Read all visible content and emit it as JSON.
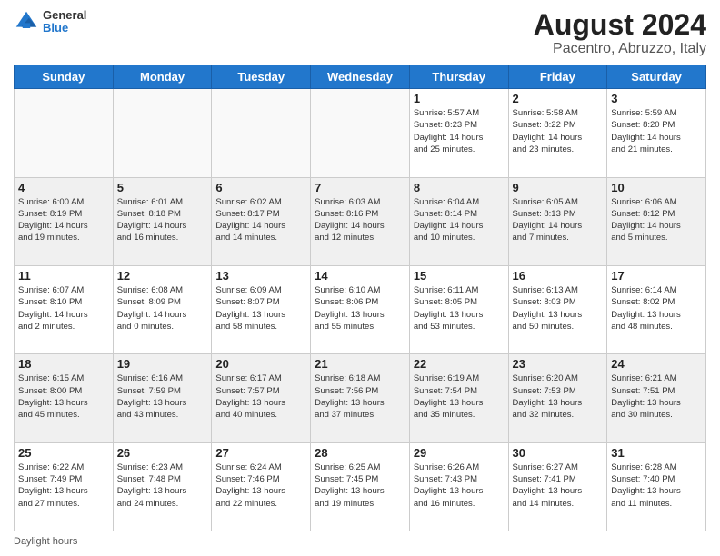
{
  "logo": {
    "text_line1": "General",
    "text_line2": "Blue"
  },
  "title": "August 2024",
  "subtitle": "Pacentro, Abruzzo, Italy",
  "days_of_week": [
    "Sunday",
    "Monday",
    "Tuesday",
    "Wednesday",
    "Thursday",
    "Friday",
    "Saturday"
  ],
  "footer_text": "Daylight hours",
  "weeks": [
    [
      {
        "day": "",
        "info": "",
        "empty": true
      },
      {
        "day": "",
        "info": "",
        "empty": true
      },
      {
        "day": "",
        "info": "",
        "empty": true
      },
      {
        "day": "",
        "info": "",
        "empty": true
      },
      {
        "day": "1",
        "info": "Sunrise: 5:57 AM\nSunset: 8:23 PM\nDaylight: 14 hours\nand 25 minutes.",
        "empty": false
      },
      {
        "day": "2",
        "info": "Sunrise: 5:58 AM\nSunset: 8:22 PM\nDaylight: 14 hours\nand 23 minutes.",
        "empty": false
      },
      {
        "day": "3",
        "info": "Sunrise: 5:59 AM\nSunset: 8:20 PM\nDaylight: 14 hours\nand 21 minutes.",
        "empty": false
      }
    ],
    [
      {
        "day": "4",
        "info": "Sunrise: 6:00 AM\nSunset: 8:19 PM\nDaylight: 14 hours\nand 19 minutes.",
        "empty": false
      },
      {
        "day": "5",
        "info": "Sunrise: 6:01 AM\nSunset: 8:18 PM\nDaylight: 14 hours\nand 16 minutes.",
        "empty": false
      },
      {
        "day": "6",
        "info": "Sunrise: 6:02 AM\nSunset: 8:17 PM\nDaylight: 14 hours\nand 14 minutes.",
        "empty": false
      },
      {
        "day": "7",
        "info": "Sunrise: 6:03 AM\nSunset: 8:16 PM\nDaylight: 14 hours\nand 12 minutes.",
        "empty": false
      },
      {
        "day": "8",
        "info": "Sunrise: 6:04 AM\nSunset: 8:14 PM\nDaylight: 14 hours\nand 10 minutes.",
        "empty": false
      },
      {
        "day": "9",
        "info": "Sunrise: 6:05 AM\nSunset: 8:13 PM\nDaylight: 14 hours\nand 7 minutes.",
        "empty": false
      },
      {
        "day": "10",
        "info": "Sunrise: 6:06 AM\nSunset: 8:12 PM\nDaylight: 14 hours\nand 5 minutes.",
        "empty": false
      }
    ],
    [
      {
        "day": "11",
        "info": "Sunrise: 6:07 AM\nSunset: 8:10 PM\nDaylight: 14 hours\nand 2 minutes.",
        "empty": false
      },
      {
        "day": "12",
        "info": "Sunrise: 6:08 AM\nSunset: 8:09 PM\nDaylight: 14 hours\nand 0 minutes.",
        "empty": false
      },
      {
        "day": "13",
        "info": "Sunrise: 6:09 AM\nSunset: 8:07 PM\nDaylight: 13 hours\nand 58 minutes.",
        "empty": false
      },
      {
        "day": "14",
        "info": "Sunrise: 6:10 AM\nSunset: 8:06 PM\nDaylight: 13 hours\nand 55 minutes.",
        "empty": false
      },
      {
        "day": "15",
        "info": "Sunrise: 6:11 AM\nSunset: 8:05 PM\nDaylight: 13 hours\nand 53 minutes.",
        "empty": false
      },
      {
        "day": "16",
        "info": "Sunrise: 6:13 AM\nSunset: 8:03 PM\nDaylight: 13 hours\nand 50 minutes.",
        "empty": false
      },
      {
        "day": "17",
        "info": "Sunrise: 6:14 AM\nSunset: 8:02 PM\nDaylight: 13 hours\nand 48 minutes.",
        "empty": false
      }
    ],
    [
      {
        "day": "18",
        "info": "Sunrise: 6:15 AM\nSunset: 8:00 PM\nDaylight: 13 hours\nand 45 minutes.",
        "empty": false
      },
      {
        "day": "19",
        "info": "Sunrise: 6:16 AM\nSunset: 7:59 PM\nDaylight: 13 hours\nand 43 minutes.",
        "empty": false
      },
      {
        "day": "20",
        "info": "Sunrise: 6:17 AM\nSunset: 7:57 PM\nDaylight: 13 hours\nand 40 minutes.",
        "empty": false
      },
      {
        "day": "21",
        "info": "Sunrise: 6:18 AM\nSunset: 7:56 PM\nDaylight: 13 hours\nand 37 minutes.",
        "empty": false
      },
      {
        "day": "22",
        "info": "Sunrise: 6:19 AM\nSunset: 7:54 PM\nDaylight: 13 hours\nand 35 minutes.",
        "empty": false
      },
      {
        "day": "23",
        "info": "Sunrise: 6:20 AM\nSunset: 7:53 PM\nDaylight: 13 hours\nand 32 minutes.",
        "empty": false
      },
      {
        "day": "24",
        "info": "Sunrise: 6:21 AM\nSunset: 7:51 PM\nDaylight: 13 hours\nand 30 minutes.",
        "empty": false
      }
    ],
    [
      {
        "day": "25",
        "info": "Sunrise: 6:22 AM\nSunset: 7:49 PM\nDaylight: 13 hours\nand 27 minutes.",
        "empty": false
      },
      {
        "day": "26",
        "info": "Sunrise: 6:23 AM\nSunset: 7:48 PM\nDaylight: 13 hours\nand 24 minutes.",
        "empty": false
      },
      {
        "day": "27",
        "info": "Sunrise: 6:24 AM\nSunset: 7:46 PM\nDaylight: 13 hours\nand 22 minutes.",
        "empty": false
      },
      {
        "day": "28",
        "info": "Sunrise: 6:25 AM\nSunset: 7:45 PM\nDaylight: 13 hours\nand 19 minutes.",
        "empty": false
      },
      {
        "day": "29",
        "info": "Sunrise: 6:26 AM\nSunset: 7:43 PM\nDaylight: 13 hours\nand 16 minutes.",
        "empty": false
      },
      {
        "day": "30",
        "info": "Sunrise: 6:27 AM\nSunset: 7:41 PM\nDaylight: 13 hours\nand 14 minutes.",
        "empty": false
      },
      {
        "day": "31",
        "info": "Sunrise: 6:28 AM\nSunset: 7:40 PM\nDaylight: 13 hours\nand 11 minutes.",
        "empty": false
      }
    ]
  ]
}
